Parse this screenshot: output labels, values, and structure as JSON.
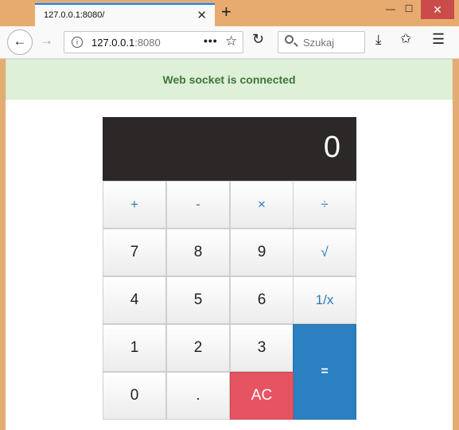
{
  "browser": {
    "tab_title": "127.0.0.1:8080/",
    "tab_close": "✕",
    "new_tab": "+",
    "url_host": "127.0.0.1",
    "url_port": ":8080",
    "search_placeholder": "Szukaj",
    "window_controls": {
      "minimize": "—",
      "maximize": "☐",
      "close": "✕"
    }
  },
  "alert": {
    "text": "Web socket is connected",
    "color": "#3c763d"
  },
  "calculator": {
    "display": "0",
    "operators": [
      "+",
      "-",
      "×",
      "÷"
    ],
    "row1": [
      "7",
      "8",
      "9",
      "√"
    ],
    "row2": [
      "4",
      "5",
      "6",
      "1/x"
    ],
    "row3": [
      "1",
      "2",
      "3"
    ],
    "row4": [
      "0",
      "."
    ],
    "clear": "AC",
    "equals": "=",
    "accent": "#2a80c0",
    "clear_color": "#e65461"
  }
}
